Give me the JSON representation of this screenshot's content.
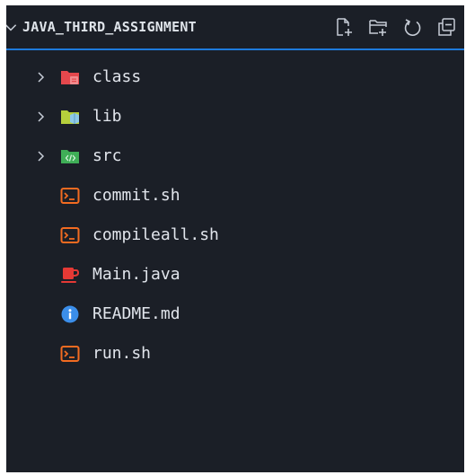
{
  "explorer": {
    "folder_title": "JAVA_THIRD_ASSIGNMENT",
    "actions": [
      {
        "icon": "new-file-icon"
      },
      {
        "icon": "new-folder-icon"
      },
      {
        "icon": "refresh-icon"
      },
      {
        "icon": "collapse-all-icon"
      }
    ],
    "items": [
      {
        "label": "class",
        "type": "folder",
        "icon": "folder-class-icon",
        "color": "#e5484d"
      },
      {
        "label": "lib",
        "type": "folder",
        "icon": "folder-lib-icon",
        "color": "#b6cf3c"
      },
      {
        "label": "src",
        "type": "folder",
        "icon": "folder-src-icon",
        "color": "#3fae57"
      },
      {
        "label": "commit.sh",
        "type": "file",
        "icon": "shell-file-icon",
        "color": "#f26b21"
      },
      {
        "label": "compileall.sh",
        "type": "file",
        "icon": "shell-file-icon",
        "color": "#f26b21"
      },
      {
        "label": "Main.java",
        "type": "file",
        "icon": "java-file-icon",
        "color": "#e53935"
      },
      {
        "label": "README.md",
        "type": "file",
        "icon": "info-file-icon",
        "color": "#3b8eea"
      },
      {
        "label": "run.sh",
        "type": "file",
        "icon": "shell-file-icon",
        "color": "#f26b21"
      }
    ],
    "accent": "#1e7bdc",
    "background": "#1b1f27"
  }
}
